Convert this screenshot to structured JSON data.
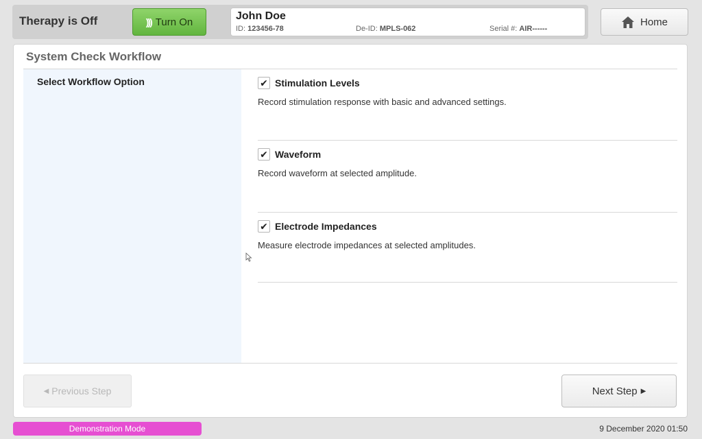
{
  "header": {
    "therapy_status": "Therapy is Off",
    "turn_on_label": "Turn On",
    "patient": {
      "name": "John Doe",
      "id_label": "ID:",
      "id_value": "123456-78",
      "deid_label": "De-ID:",
      "deid_value": "MPLS-062",
      "serial_label": "Serial #:",
      "serial_value": "AIR------"
    },
    "home_label": "Home"
  },
  "workflow": {
    "title": "System Check Workflow",
    "left_label": "Select Workflow Option",
    "options": [
      {
        "title": "Stimulation Levels",
        "description": "Record stimulation response with basic and advanced settings.",
        "checked": true
      },
      {
        "title": "Waveform",
        "description": "Record waveform at selected amplitude.",
        "checked": true
      },
      {
        "title": "Electrode Impedances",
        "description": "Measure electrode impedances at selected amplitudes.",
        "checked": true
      }
    ],
    "prev_label": "Previous Step",
    "next_label": "Next Step"
  },
  "footer": {
    "mode_label": "Demonstration Mode",
    "datetime": "9 December 2020 01:50"
  },
  "colors": {
    "turn_on_green": "#62b53f",
    "demo_badge_magenta": "#e64fd2",
    "left_column_bg": "#f0f6fd"
  }
}
